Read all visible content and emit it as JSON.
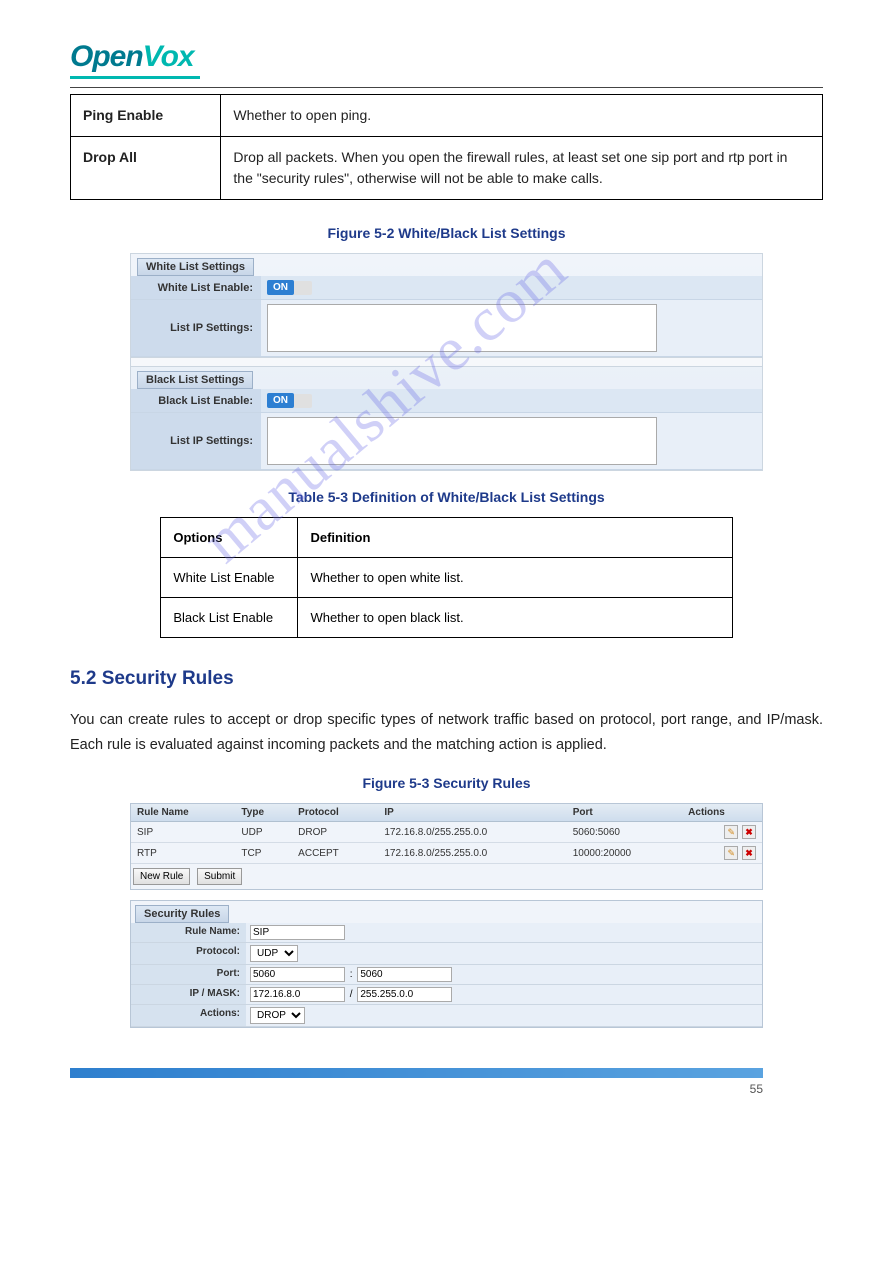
{
  "logo": {
    "part1": "Open",
    "part2": "Vox"
  },
  "def_table": [
    {
      "label": "Ping Enable",
      "desc": "Whether to open ping."
    },
    {
      "label": "Drop All",
      "desc": "Drop all packets. When you open the firewall rules, at least set one sip port and rtp port in the \"security rules\", otherwise will not be able to make calls."
    }
  ],
  "figures": {
    "fig2": "Figure 5-2 White/Black List Settings",
    "fig3": "Figure 5-3 Security Rules"
  },
  "tables": {
    "tbl53_caption": "Table 5-3 Definition of White/Black List Settings",
    "tbl53_header": {
      "opt": "Options",
      "def": "Definition"
    },
    "tbl53_rows": [
      {
        "opt": "White List Enable",
        "def": "Whether to open white list."
      },
      {
        "opt": "Black List Enable",
        "def": "Whether to open black list."
      }
    ]
  },
  "panel": {
    "whitelist_tab": "White List Settings",
    "whitelist_enable_label": "White List Enable:",
    "whitelist_ip_label": "List IP Settings:",
    "blacklist_tab": "Black List Settings",
    "blacklist_enable_label": "Black List Enable:",
    "blacklist_ip_label": "List IP Settings:",
    "on": "ON"
  },
  "section_heading": "5.2 Security Rules",
  "body_para": "You can create rules to accept or drop specific types of network traffic based on protocol, port range, and IP/mask. Each rule is evaluated against incoming packets and the matching action is applied.",
  "rules": {
    "headers": {
      "name": "Rule Name",
      "type": "Type",
      "proto": "Protocol",
      "ip": "IP",
      "port": "Port",
      "actions": "Actions"
    },
    "rows": [
      {
        "name": "SIP",
        "type": "UDP",
        "proto": "DROP",
        "ip": "172.16.8.0/255.255.0.0",
        "port": "5060:5060"
      },
      {
        "name": "RTP",
        "type": "TCP",
        "proto": "ACCEPT",
        "ip": "172.16.8.0/255.255.0.0",
        "port": "10000:20000"
      }
    ],
    "new_rule_btn": "New Rule",
    "submit_btn": "Submit"
  },
  "sec_form": {
    "tab": "Security Rules",
    "rule_name_label": "Rule Name:",
    "rule_name_val": "SIP",
    "protocol_label": "Protocol:",
    "protocol_val": "UDP",
    "port_label": "Port:",
    "port_from": "5060",
    "port_to": "5060",
    "ipmask_label": "IP / MASK:",
    "ip_val": "172.16.8.0",
    "mask_sep": "/",
    "mask_val": "255.255.0.0",
    "actions_label": "Actions:",
    "actions_val": "DROP"
  },
  "page_number": "55",
  "watermark": "manualshive.com",
  "icons": {
    "edit": "✎",
    "del": "✖",
    "dropdown": "▼"
  }
}
